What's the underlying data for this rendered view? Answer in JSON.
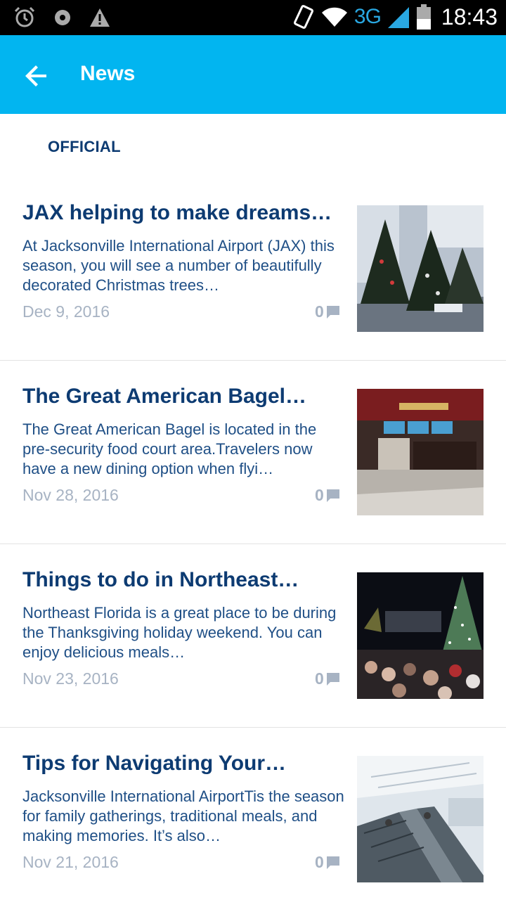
{
  "status_bar": {
    "network": "3G",
    "time": "18:43",
    "icons": [
      "alarm-icon",
      "record-icon",
      "warning-icon",
      "vibrate-icon",
      "wifi-icon",
      "signal-icon",
      "battery-icon"
    ]
  },
  "app_bar": {
    "title": "News",
    "back_icon": "arrow-left-icon",
    "color": "#02b5f0"
  },
  "section": {
    "label": "OFFICIAL"
  },
  "articles": [
    {
      "title": "JAX helping to make dreams…",
      "excerpt": "  At Jacksonville International Airport (JAX) this season, you will see a number of beautifully decorated Christmas trees…",
      "date": "Dec 9, 2016",
      "comments": "0",
      "thumbnail": "christmas-trees-terminal"
    },
    {
      "title": "The Great American Bagel…",
      "excerpt": "The Great American Bagel is located in the pre-security food court area.Travelers now have a new dining option when flyi…",
      "date": "Nov 28, 2016",
      "comments": "0",
      "thumbnail": "food-court-counter"
    },
    {
      "title": "Things to do in Northeast…",
      "excerpt": "Northeast Florida is a great place to be during the Thanksgiving holiday weekend. You can enjoy delicious meals…",
      "date": "Nov 23, 2016",
      "comments": "0",
      "thumbnail": "night-crowd-christmas-tree"
    },
    {
      "title": "Tips for Navigating Your…",
      "excerpt": "Jacksonville International AirportTis the season for family gatherings, traditional meals, and making memories. It’s also…",
      "date": "Nov 21, 2016",
      "comments": "0",
      "thumbnail": "airport-escalators"
    }
  ],
  "colors": {
    "title_text": "#0d3b72",
    "body_text": "#1f4f86",
    "meta_text": "#a7b3c3"
  }
}
